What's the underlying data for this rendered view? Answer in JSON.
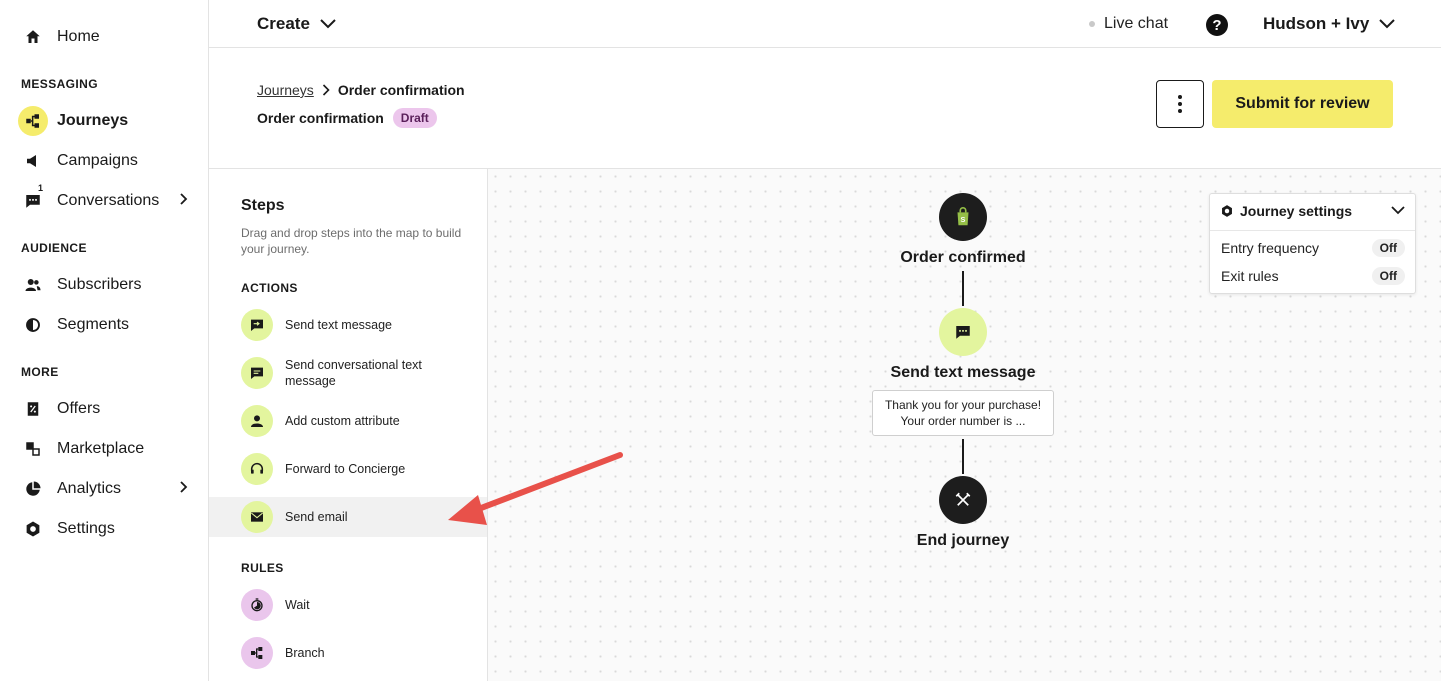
{
  "sidebar": {
    "home": "Home",
    "messaging_header": "MESSAGING",
    "journeys": "Journeys",
    "campaigns": "Campaigns",
    "conversations": "Conversations",
    "conversations_badge": "1",
    "audience_header": "AUDIENCE",
    "subscribers": "Subscribers",
    "segments": "Segments",
    "more_header": "MORE",
    "offers": "Offers",
    "marketplace": "Marketplace",
    "analytics": "Analytics",
    "settings": "Settings"
  },
  "topbar": {
    "create": "Create",
    "live_chat": "Live chat",
    "help": "?",
    "account": "Hudson + Ivy"
  },
  "header": {
    "breadcrumb_root": "Journeys",
    "breadcrumb_current": "Order confirmation",
    "title": "Order confirmation",
    "status": "Draft",
    "submit": "Submit for review"
  },
  "steps": {
    "title": "Steps",
    "description": "Drag and drop steps into the map to build your journey.",
    "actions_header": "ACTIONS",
    "actions": [
      "Send text message",
      "Send conversational text message",
      "Add custom attribute",
      "Forward to Concierge",
      "Send email"
    ],
    "rules_header": "RULES",
    "rules": [
      "Wait",
      "Branch"
    ]
  },
  "journey": {
    "trigger": "Order confirmed",
    "action": "Send text message",
    "preview": [
      "Thank you for your purchase!",
      "Your order number is ..."
    ],
    "end": "End journey"
  },
  "journey_settings": {
    "title": "Journey settings",
    "entry_frequency": "Entry frequency",
    "entry_frequency_value": "Off",
    "exit_rules": "Exit rules",
    "exit_rules_value": "Off"
  },
  "colors": {
    "accent_yellow": "#f5ec6c",
    "action_green": "#e3f59e",
    "rule_pink": "#eac6ec",
    "arrow_red": "#e8514a"
  }
}
